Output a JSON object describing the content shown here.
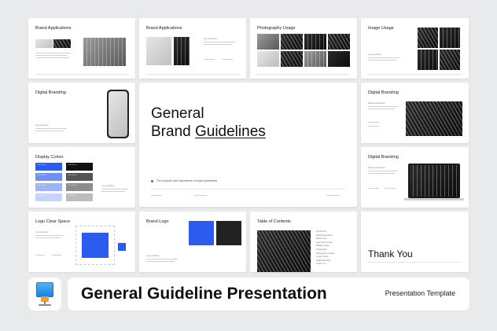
{
  "slides": {
    "brand_applications_1": {
      "title": "Brand Applications"
    },
    "brand_applications_2": {
      "title": "Brand Applications",
      "small_label": "Logo guidelines"
    },
    "photography_usage": {
      "title": "Photography Usage"
    },
    "image_usage": {
      "title": "Image Usage",
      "small_label": "Logo guidelines"
    },
    "digital_branding_1": {
      "title": "Digital Branding",
      "small_label": "Logo guidelines"
    },
    "hero": {
      "title_line1": "General",
      "title_line2_prefix": "Brand ",
      "title_line2_underlined": "Guidelines",
      "caption": "The purpose and importance of brand guidelines"
    },
    "digital_branding_2": {
      "title": "Digital Branding",
      "small_label": "Website applications"
    },
    "display_colors": {
      "title": "Display Colors",
      "small_label": "Logo guidelines",
      "swatches": [
        {
          "label": "Color Name",
          "color": "#2c5bf0"
        },
        {
          "label": "Color Name",
          "color": "#111111"
        },
        {
          "label": "Color Name",
          "color": "#6f8ff4"
        },
        {
          "label": "Color Name",
          "color": "#555555"
        },
        {
          "label": "Color Name",
          "color": "#9fb4f7"
        },
        {
          "label": "Color Name",
          "color": "#8c8c8c"
        },
        {
          "label": "Color Name",
          "color": "#c6d3fa"
        },
        {
          "label": "Color Name",
          "color": "#bcbcbc"
        }
      ]
    },
    "digital_branding_3": {
      "title": "Digital Branding",
      "small_label": "Website applications"
    },
    "logo_clear_space": {
      "title": "Logo Clear Space",
      "small_label": "Logo guidelines"
    },
    "brand_logo": {
      "title": "Brand Logo",
      "small_label": "Logo guidelines"
    },
    "table_of_contents": {
      "title": "Table of Contents",
      "items": [
        "Introduction",
        "Brand Applications",
        "Brand Logo",
        "Logo Clear Space",
        "Display Colors",
        "Typography",
        "Photography Usage",
        "Image Usage",
        "Digital Branding",
        "Thank You"
      ]
    },
    "thank_you": {
      "title": "Thank You"
    }
  },
  "banner": {
    "app_icon": "keynote-icon",
    "title": "General Guideline Presentation",
    "subtitle": "Presentation Template"
  },
  "colors": {
    "accent_blue": "#2c5bf0",
    "background": "#e9eaec"
  }
}
